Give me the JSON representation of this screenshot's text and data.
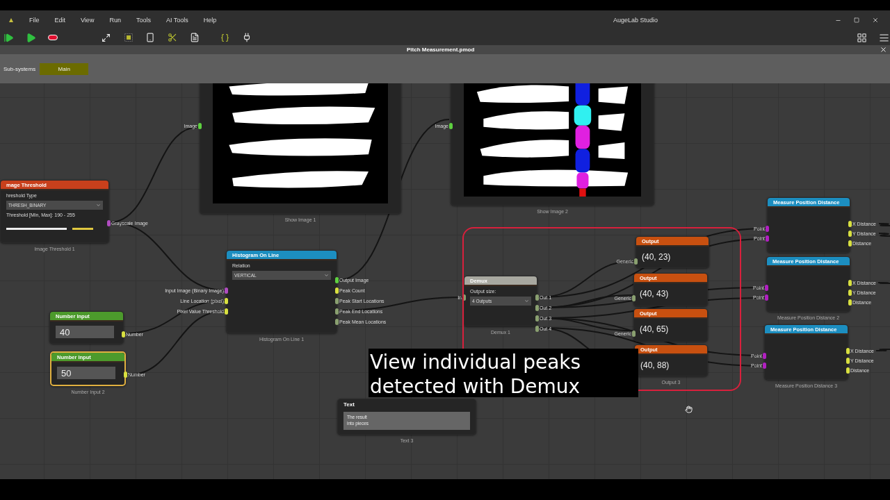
{
  "app": {
    "title": "AugeLab Studio"
  },
  "menu": [
    "File",
    "Edit",
    "View",
    "Run",
    "Tools",
    "AI Tools",
    "Help"
  ],
  "document_tab": {
    "title": "Pitch Measurement.pmod"
  },
  "subsystems": {
    "label": "Sub-systems",
    "items": [
      {
        "label": "Main",
        "selected": true
      }
    ]
  },
  "nodes": [
    {
      "kind": "threshold",
      "title": "mage Threshold",
      "color": "#c8401c",
      "selected": false,
      "caption": "Image Threshold 1",
      "rows": [
        {
          "kind": "label",
          "text": "hreshold Type"
        },
        {
          "kind": "dropdown",
          "value": "THRESH_BINARY"
        },
        {
          "kind": "label",
          "text": "Threshold [Min, Max]: 190 - 255"
        },
        {
          "kind": "range"
        }
      ],
      "outputs": [
        {
          "label": "Grayscale Image",
          "color": "#b04cc0"
        }
      ]
    },
    {
      "selected": false,
      "caption": "Show Image 1",
      "rows": [
        {
          "kind": "picture"
        }
      ],
      "inputs": [
        {
          "label": "Image",
          "color": "#5ed040"
        }
      ]
    },
    {
      "selected": false,
      "caption": "Show Image 2",
      "rows": [
        {
          "kind": "picture"
        }
      ],
      "inputs": [
        {
          "label": "Image",
          "color": "#5ed040"
        }
      ]
    },
    {
      "kind": "histogram",
      "title": "Histogram On Line",
      "color": "#1c8ec0",
      "selected": false,
      "caption": "Histogram On Line 1",
      "rows": [
        {
          "kind": "label",
          "text": "Relation"
        },
        {
          "kind": "dropdown",
          "value": "VERTICAL"
        }
      ],
      "inputs": [
        {
          "label": "Input Image (Binary Image)",
          "color": "#b04cc0"
        },
        {
          "label": "Line Location (pixel)",
          "color": "#d8e040"
        },
        {
          "label": "Pixel Value Threshold",
          "color": "#d8e040"
        }
      ],
      "outputs": [
        {
          "label": "Output Image",
          "color": "#5ed040"
        },
        {
          "label": "Peak Count",
          "color": "#d8e040"
        },
        {
          "label": "Peak Start Locations",
          "color": "#8aa070"
        },
        {
          "label": "Peak End Locations",
          "color": "#8aa070"
        },
        {
          "label": "Peak Mean Locations",
          "color": "#8aa070"
        }
      ]
    },
    {
      "kind": "number",
      "title": "Number Input",
      "color": "#4c9a2c",
      "selected": false,
      "rows": [
        {
          "kind": "number",
          "value": "40"
        }
      ],
      "outputs": [
        {
          "label": "Number",
          "color": "#d8e040"
        }
      ]
    },
    {
      "kind": "number",
      "title": "Number Input",
      "color": "#4c9a2c",
      "selected": true,
      "caption": "Number Input 2",
      "rows": [
        {
          "kind": "number",
          "value": "50"
        }
      ],
      "outputs": [
        {
          "label": "Number",
          "color": "#d8e040"
        }
      ]
    },
    {
      "kind": "text",
      "title": "Text",
      "selected": false,
      "caption": "Text 3",
      "rows": [
        {
          "kind": "textarea",
          "lines": [
            "The result",
            "into pieces"
          ]
        }
      ]
    },
    {
      "kind": "demux",
      "title": "Demux",
      "color": "#a8a8a0",
      "selected": false,
      "caption": "Demux 1",
      "rows": [
        {
          "kind": "label",
          "text": "Output size:"
        },
        {
          "kind": "dropdown",
          "value": "4 Outputs"
        }
      ],
      "inputs": [
        {
          "label": "In",
          "color": "#8aa070"
        }
      ],
      "outputs": [
        {
          "label": "Out 1",
          "color": "#8aa070"
        },
        {
          "label": "Out 2",
          "color": "#8aa070"
        },
        {
          "label": "Out 3",
          "color": "#8aa070"
        },
        {
          "label": "Out 4",
          "color": "#8aa070"
        }
      ]
    },
    {
      "kind": "output",
      "title": "Output",
      "color": "#c85010",
      "selected": false,
      "rows": [
        {
          "kind": "value",
          "text": "(40, 23)"
        }
      ],
      "inputs": [
        {
          "label": "Generic",
          "color": "#8aa070"
        }
      ]
    },
    {
      "kind": "output",
      "title": "Output",
      "color": "#c85010",
      "selected": false,
      "rows": [
        {
          "kind": "value",
          "text": "(40, 43)"
        }
      ],
      "inputs": [
        {
          "label": "Generic",
          "color": "#8aa070"
        }
      ]
    },
    {
      "kind": "output",
      "title": "Output",
      "color": "#c85010",
      "selected": false,
      "rows": [
        {
          "kind": "value",
          "text": "(40, 65)"
        }
      ],
      "inputs": [
        {
          "label": "Generic",
          "color": "#8aa070"
        }
      ]
    },
    {
      "kind": "output",
      "title": "Output",
      "color": "#c85010",
      "selected": false,
      "caption": "Output 3",
      "rows": [
        {
          "kind": "value",
          "text": "(40, 88)"
        }
      ]
    },
    {
      "kind": "measure",
      "title": "Measure Position Distance",
      "color": "#1c8ec0",
      "selected": false,
      "inputs": [
        {
          "label": "Point",
          "color": "#b020c0"
        },
        {
          "label": "Point",
          "color": "#b020c0"
        }
      ],
      "outputs": [
        {
          "label": "X Distance",
          "color": "#d8e040"
        },
        {
          "label": "Y Distance",
          "color": "#d8e040"
        },
        {
          "label": "Distance",
          "color": "#d8e040"
        }
      ]
    },
    {
      "kind": "measure",
      "title": "Measure Position Distance",
      "color": "#1c8ec0",
      "selected": false,
      "caption": "Measure Position Distance 2",
      "inputs": [
        {
          "label": "Point",
          "color": "#b020c0"
        },
        {
          "label": "Point",
          "color": "#b020c0"
        }
      ],
      "outputs": [
        {
          "label": "X Distance",
          "color": "#d8e040"
        },
        {
          "label": "Y Distance",
          "color": "#d8e040"
        },
        {
          "label": "Distance",
          "color": "#d8e040"
        }
      ]
    },
    {
      "kind": "measure",
      "title": "Measure Position Distance",
      "color": "#1c8ec0",
      "selected": false,
      "caption": "Measure Position Distance 3",
      "inputs": [
        {
          "label": "Point",
          "color": "#b020c0"
        },
        {
          "label": "Point",
          "color": "#b020c0"
        }
      ],
      "outputs": [
        {
          "label": "X Distance",
          "color": "#d8e040"
        },
        {
          "label": "Y Distance",
          "color": "#d8e040"
        },
        {
          "label": "Distance",
          "color": "#d8e040"
        }
      ]
    }
  ],
  "subtitle": [
    "View individual peaks",
    "detected with Demux"
  ]
}
